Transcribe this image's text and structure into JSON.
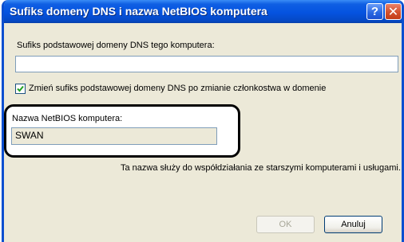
{
  "dialog": {
    "title": "Sufiks domeny DNS i nazwa NetBIOS komputera",
    "help_glyph": "?",
    "close_glyph": "✕"
  },
  "dns_suffix": {
    "label": "Sufiks podstawowej domeny DNS tego komputera:",
    "value": ""
  },
  "change_suffix_checkbox": {
    "label": "Zmień sufiks podstawowej domeny DNS po zmianie członkostwa w domenie",
    "checked": true
  },
  "netbios": {
    "label": "Nazwa NetBIOS komputera:",
    "value": "SWAN",
    "note": "Ta nazwa służy do współdziałania ze starszymi komputerami i usługami."
  },
  "buttons": {
    "ok": "OK",
    "cancel": "Anuluj"
  }
}
